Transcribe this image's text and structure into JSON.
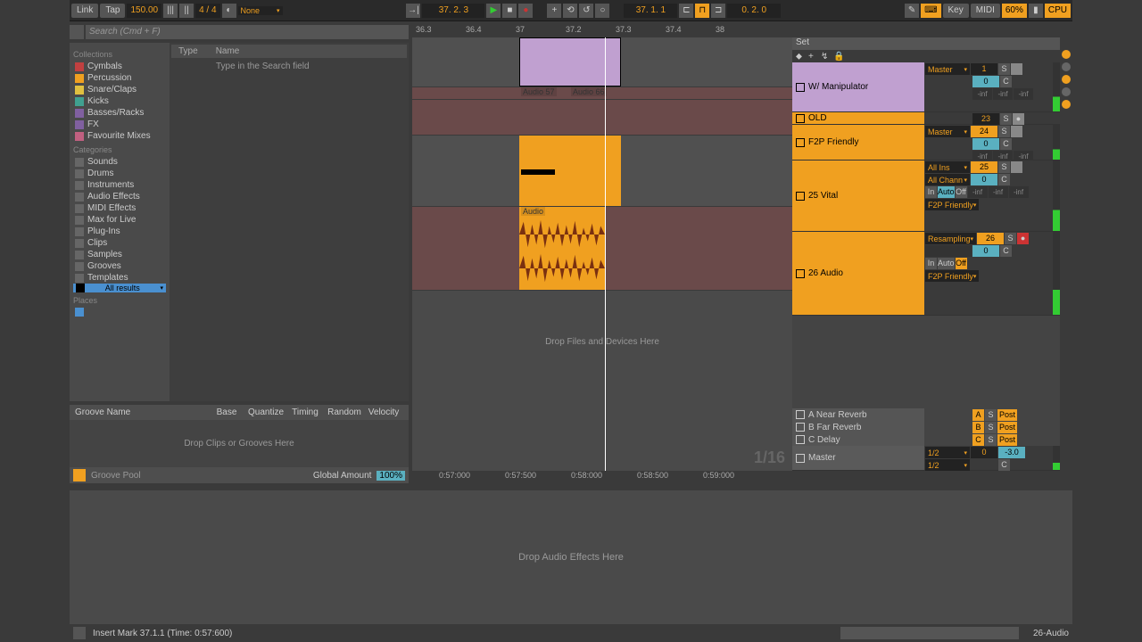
{
  "topbar": {
    "link": "Link",
    "tap": "Tap",
    "tempo": "150.00",
    "sig": "4 / 4",
    "quantize": "None",
    "pos": "37.  2.  3",
    "pos2": "37.  1.  1",
    "loop": "0.  2.  0",
    "key": "Key",
    "midi": "MIDI",
    "cpu": "CPU",
    "pct": "60%"
  },
  "search": {
    "placeholder": "Search (Cmd + F)"
  },
  "collections_label": "Collections",
  "collections": [
    {
      "label": "Cymbals"
    },
    {
      "label": "Percussion"
    },
    {
      "label": "Snare/Claps"
    },
    {
      "label": "Kicks"
    },
    {
      "label": "Basses/Racks"
    },
    {
      "label": "FX"
    },
    {
      "label": "Favourite Mixes"
    }
  ],
  "categories_label": "Categories",
  "categories": [
    {
      "label": "Sounds"
    },
    {
      "label": "Drums"
    },
    {
      "label": "Instruments"
    },
    {
      "label": "Audio Effects"
    },
    {
      "label": "MIDI Effects"
    },
    {
      "label": "Max for Live"
    },
    {
      "label": "Plug-Ins"
    },
    {
      "label": "Clips"
    },
    {
      "label": "Samples"
    },
    {
      "label": "Grooves"
    },
    {
      "label": "Templates"
    },
    {
      "label": "All results"
    }
  ],
  "places_label": "Places",
  "content": {
    "type": "Type",
    "name": "Name",
    "hint": "Type in the Search field"
  },
  "groove": {
    "name": "Groove Name",
    "base": "Base",
    "quantize": "Quantize",
    "timing": "Timing",
    "random": "Random",
    "velocity": "Velocity",
    "drop": "Drop Clips or Grooves Here",
    "pool": "Groove Pool",
    "amount_label": "Global Amount",
    "amount": "100%"
  },
  "ruler": [
    "36.3",
    "36.4",
    "37",
    "37.2",
    "37.3",
    "37.4",
    "38"
  ],
  "clips": {
    "audio57": "Audio 57",
    "audio66": "Audio 66",
    "audio": "Audio"
  },
  "drop_arr": "Drop Files and Devices Here",
  "big_time": "1/16",
  "time": [
    "0:57:000",
    "0:57:500",
    "0:58:000",
    "0:58:500",
    "0:59:000"
  ],
  "set": {
    "label": "Set"
  },
  "tracks": [
    {
      "name": "W/ Manipulator",
      "route": "Master",
      "num": "1",
      "s": "S",
      "c0": "0",
      "c": "C",
      "inf": "-inf"
    },
    {
      "name": "OLD",
      "num": "23",
      "s": "S"
    },
    {
      "name": "F2P Friendly",
      "route": "Master",
      "num": "24",
      "s": "S",
      "c0": "0",
      "c": "C",
      "inf": "-inf"
    },
    {
      "name": "25 Vital",
      "route": "All Ins",
      "chan": "All Chann",
      "num": "25",
      "s": "S",
      "c0": "0",
      "c": "C",
      "in": "In",
      "auto": "Auto",
      "off": "Off",
      "group": "F2P Friendly"
    },
    {
      "name": "26 Audio",
      "route": "Resampling",
      "num": "26",
      "s": "S",
      "c0": "0",
      "c": "C",
      "in": "In",
      "auto": "Auto",
      "off": "Off",
      "group": "F2P Friendly"
    }
  ],
  "returns": [
    {
      "name": "A Near Reverb",
      "btn": "A",
      "s": "S",
      "post": "Post"
    },
    {
      "name": "B Far Reverb",
      "btn": "B",
      "s": "S",
      "post": "Post"
    },
    {
      "name": "C Delay",
      "btn": "C",
      "s": "S",
      "post": "Post"
    }
  ],
  "master": {
    "name": "Master",
    "sel": "1/2",
    "val": "-3.0",
    "c0": "0",
    "c": "C",
    "num": "0"
  },
  "detail": {
    "drop": "Drop Audio Effects Here"
  },
  "status": {
    "text": "Insert Mark 37.1.1 (Time: 0:57:600)",
    "track": "26-Audio"
  }
}
